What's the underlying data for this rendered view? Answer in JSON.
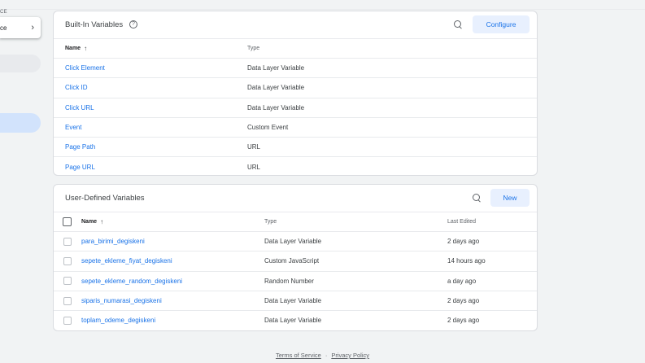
{
  "sidebar": {
    "section_label": "CE",
    "workspace_label": "ce"
  },
  "builtin": {
    "title": "Built-In Variables",
    "configure_label": "Configure",
    "col_name": "Name",
    "col_type": "Type",
    "rows": [
      {
        "name": "Click Element",
        "type": "Data Layer Variable"
      },
      {
        "name": "Click ID",
        "type": "Data Layer Variable"
      },
      {
        "name": "Click URL",
        "type": "Data Layer Variable"
      },
      {
        "name": "Event",
        "type": "Custom Event"
      },
      {
        "name": "Page Path",
        "type": "URL"
      },
      {
        "name": "Page URL",
        "type": "URL"
      }
    ]
  },
  "user": {
    "title": "User-Defined Variables",
    "new_label": "New",
    "col_name": "Name",
    "col_type": "Type",
    "col_edited": "Last Edited",
    "rows": [
      {
        "name": "para_birimi_degiskeni",
        "type": "Data Layer Variable",
        "edited": "2 days ago"
      },
      {
        "name": "sepete_ekleme_fiyat_degiskeni",
        "type": "Custom JavaScript",
        "edited": "14 hours ago"
      },
      {
        "name": "sepete_ekleme_random_degiskeni",
        "type": "Random Number",
        "edited": "a day ago"
      },
      {
        "name": "siparis_numarasi_degiskeni",
        "type": "Data Layer Variable",
        "edited": "2 days ago"
      },
      {
        "name": "toplam_odeme_degiskeni",
        "type": "Data Layer Variable",
        "edited": "2 days ago"
      }
    ]
  },
  "footer": {
    "terms": "Terms of Service",
    "separator": "·",
    "privacy": "Privacy Policy"
  },
  "colors": {
    "accent": "#1a73e8",
    "button_bg": "#e8f0fe",
    "active_nav": "#d2e3fc",
    "background": "#f1f3f4"
  },
  "icons": {
    "help": "help-circle-icon",
    "search": "search-icon",
    "sort": "arrow-up-icon",
    "chevron": "chevron-right-icon"
  }
}
